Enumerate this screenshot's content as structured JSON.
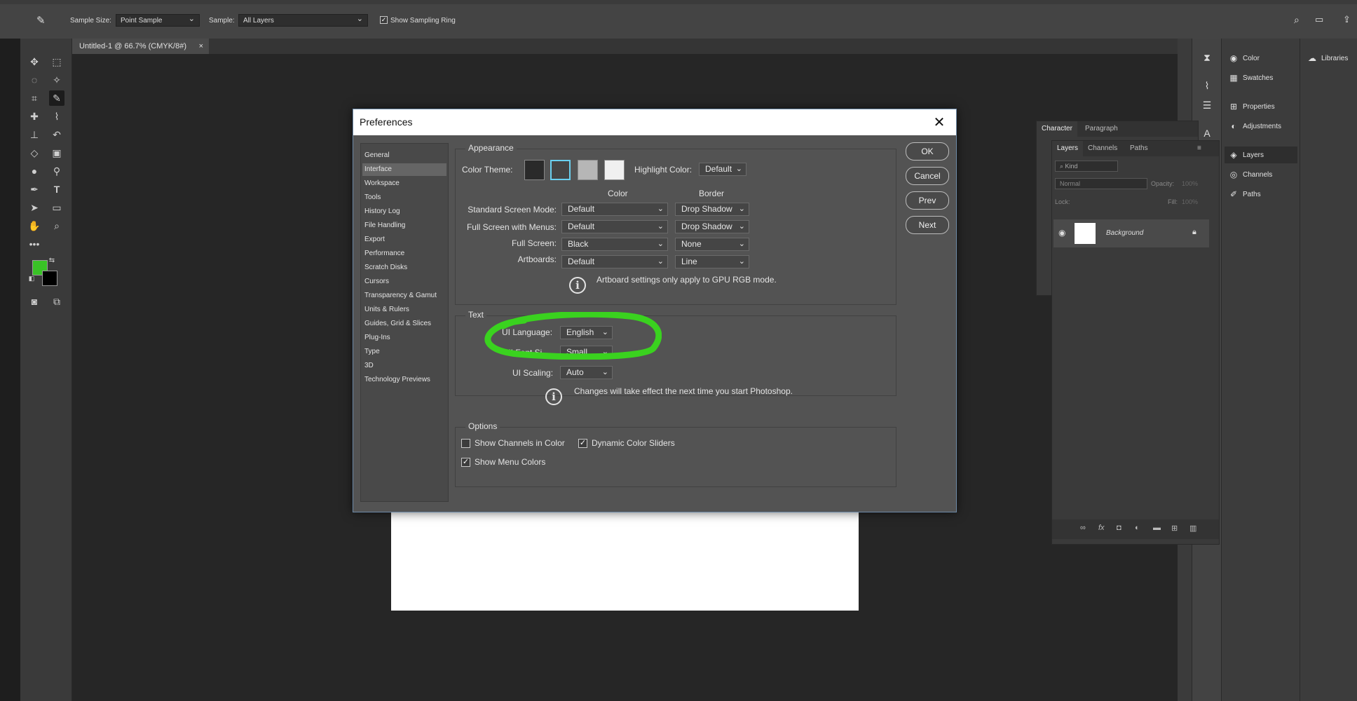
{
  "options_bar": {
    "sample_size_label": "Sample Size:",
    "sample_size_value": "Point Sample",
    "sample_label": "Sample:",
    "sample_value": "All Layers",
    "show_sampling_ring": "Show Sampling Ring"
  },
  "document": {
    "tab_title": "Untitled-1 @ 66.7% (CMYK/8#)"
  },
  "dialog": {
    "title": "Preferences",
    "nav": [
      "General",
      "Interface",
      "Workspace",
      "Tools",
      "History Log",
      "File Handling",
      "Export",
      "Performance",
      "Scratch Disks",
      "Cursors",
      "Transparency & Gamut",
      "Units & Rulers",
      "Guides, Grid & Slices",
      "Plug-Ins",
      "Type",
      "3D",
      "Technology Previews"
    ],
    "selected_nav": "Interface",
    "buttons": {
      "ok": "OK",
      "cancel": "Cancel",
      "prev": "Prev",
      "next": "Next"
    },
    "appearance": {
      "title": "Appearance",
      "color_theme_label": "Color Theme:",
      "highlight_label": "Highlight Color:",
      "highlight_value": "Default",
      "color_header": "Color",
      "border_header": "Border",
      "rows": [
        {
          "label": "Standard Screen Mode:",
          "color": "Default",
          "border": "Drop Shadow"
        },
        {
          "label": "Full Screen with Menus:",
          "color": "Default",
          "border": "Drop Shadow"
        },
        {
          "label": "Full Screen:",
          "color": "Black",
          "border": "None"
        },
        {
          "label": "Artboards:",
          "color": "Default",
          "border": "Line"
        }
      ],
      "note": "Artboard settings only apply to GPU RGB mode."
    },
    "text": {
      "title": "Text",
      "ui_language_label": "UI Language:",
      "ui_language_value": "English",
      "ui_font_label": "UI Font Si",
      "ui_font_value": "Small",
      "ui_scaling_label": "UI Scaling:",
      "ui_scaling_value": "Auto",
      "note": "Changes will take effect the next time you start Photoshop."
    },
    "options": {
      "title": "Options",
      "show_channels": "Show Channels in Color",
      "dynamic_sliders": "Dynamic Color Sliders",
      "show_menu_colors": "Show Menu Colors"
    }
  },
  "panels": {
    "char_tabs": [
      "Character",
      "Paragraph"
    ],
    "layers_tabs": [
      "Layers",
      "Channels",
      "Paths"
    ],
    "kind_label": "Kind",
    "blend_mode": "Normal",
    "opacity_label": "Opacity:",
    "opacity_value": "100%",
    "lock_label": "Lock:",
    "fill_label": "Fill:",
    "fill_value": "100%",
    "layer_name": "Background",
    "side_items": [
      "Color",
      "Swatches",
      "Properties",
      "Adjustments",
      "Layers",
      "Channels",
      "Paths"
    ],
    "libraries": "Libraries"
  },
  "colors": {
    "annotation": "#3ad21f",
    "foreground": "#39c226",
    "dialog_bg": "#535353"
  }
}
